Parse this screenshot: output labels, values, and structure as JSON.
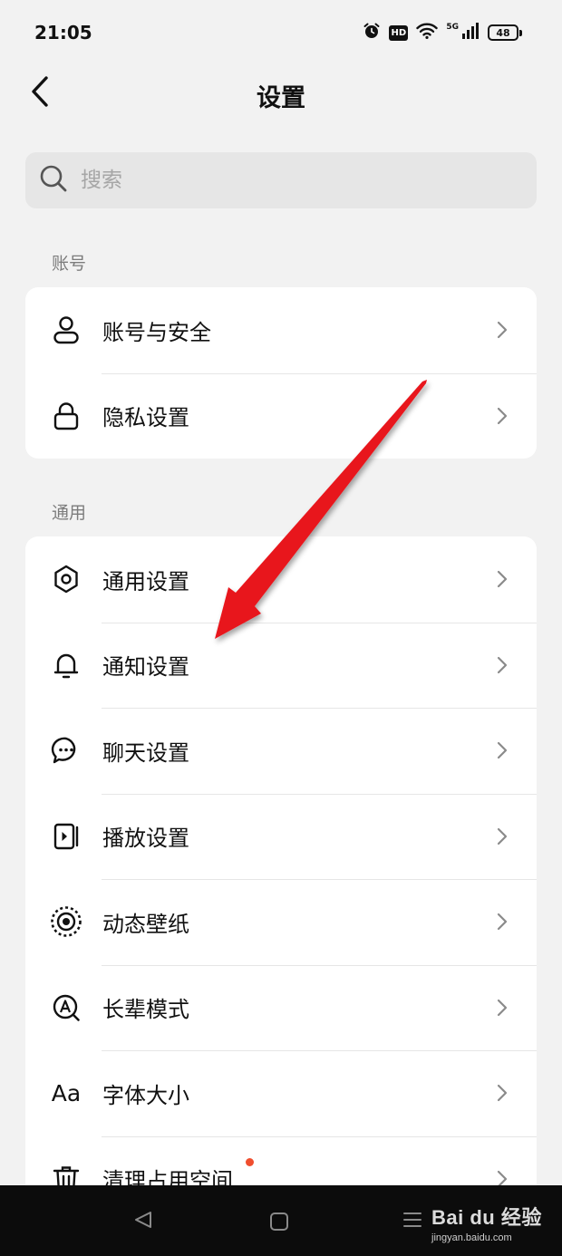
{
  "status_bar": {
    "time": "21:05",
    "network": "5G",
    "battery": "48",
    "icons": [
      "alarm-icon",
      "hd-icon",
      "wifi-icon",
      "signal-icon",
      "battery-icon"
    ],
    "hd_label": "HD"
  },
  "nav": {
    "title": "设置",
    "back_icon": "chevron-left-icon"
  },
  "search": {
    "placeholder": "搜索",
    "value": "",
    "icon": "search-icon"
  },
  "sections": [
    {
      "label": "账号",
      "items": [
        {
          "label": "账号与安全",
          "icon": "user-icon"
        },
        {
          "label": "隐私设置",
          "icon": "lock-icon"
        }
      ]
    },
    {
      "label": "通用",
      "items": [
        {
          "label": "通用设置",
          "icon": "gear-icon"
        },
        {
          "label": "通知设置",
          "icon": "bell-icon"
        },
        {
          "label": "聊天设置",
          "icon": "chat-bubble-icon"
        },
        {
          "label": "播放设置",
          "icon": "play-screen-icon"
        },
        {
          "label": "动态壁纸",
          "icon": "wallpaper-icon"
        },
        {
          "label": "长辈模式",
          "icon": "elder-mode-icon"
        },
        {
          "label": "字体大小",
          "icon": "font-size-icon",
          "icon_text": "Aa"
        },
        {
          "label": "清理占用空间",
          "icon": "trash-icon",
          "badge": "red-dot"
        }
      ]
    }
  ],
  "annotation": {
    "type": "red-arrow",
    "points_to": "通知设置",
    "color": "#e8141b"
  },
  "system_nav": {
    "icons": [
      "triangle-back-icon",
      "square-home-icon",
      "menu-icon"
    ]
  },
  "watermark": {
    "brand": "Bai du 经验",
    "url": "jingyan.baidu.com"
  },
  "colors": {
    "background": "#f2f2f2",
    "card": "#ffffff",
    "search_bg": "#e6e6e6",
    "section_label": "#7c7c7c",
    "badge": "#f04e2e",
    "system_nav": "#0c0c0c"
  }
}
